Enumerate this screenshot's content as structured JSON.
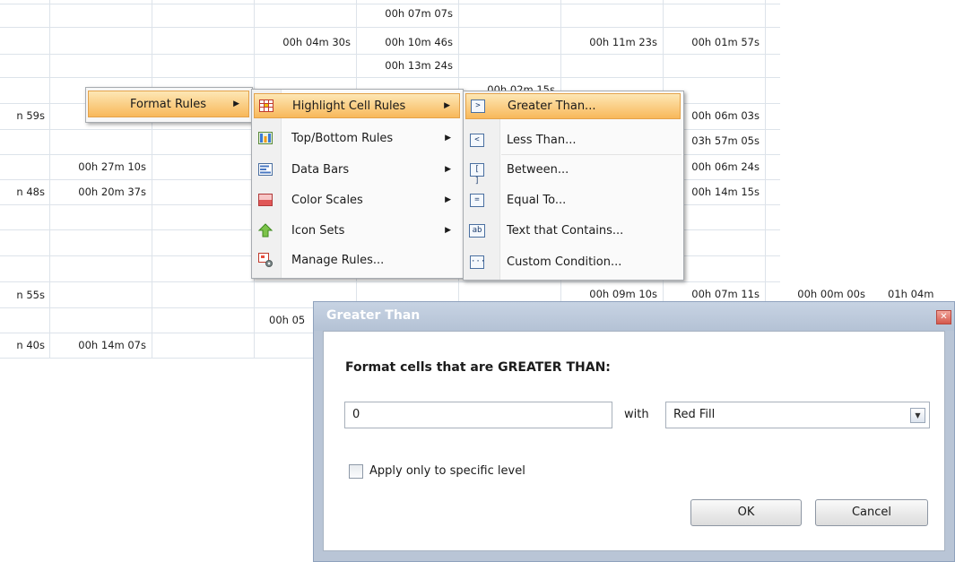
{
  "grid": {
    "cells": [
      {
        "id": "r0c4",
        "text": "00h 07m 07s"
      },
      {
        "id": "r1c3",
        "text": "00h 04m 30s"
      },
      {
        "id": "r1c4",
        "text": "00h 10m 46s"
      },
      {
        "id": "r1c6",
        "text": "00h 11m 23s"
      },
      {
        "id": "r1c7",
        "text": "00h 01m 57s"
      },
      {
        "id": "r2c4",
        "text": "00h 13m 24s"
      },
      {
        "id": "r3c5",
        "text": "00h 02m 15s"
      },
      {
        "id": "r4c0",
        "text": "n 59s"
      },
      {
        "id": "r4c7",
        "text": "00h 06m 03s"
      },
      {
        "id": "r5c7",
        "text": "03h 57m 05s"
      },
      {
        "id": "r6c1",
        "text": "00h 27m 10s"
      },
      {
        "id": "r6c7",
        "text": "00h 06m 24s"
      },
      {
        "id": "r7c0",
        "text": "n 48s"
      },
      {
        "id": "r7c1",
        "text": "00h 20m 37s"
      },
      {
        "id": "r7c7",
        "text": "00h 14m 15s"
      },
      {
        "id": "r10c0",
        "text": "n 55s"
      },
      {
        "id": "r10c6",
        "text": "00h 09m 10s"
      },
      {
        "id": "r10c7",
        "text": "00h 07m 11s"
      },
      {
        "id": "r10c8",
        "text": "00h 00m 00s"
      },
      {
        "id": "r10c9",
        "text": "01h 04m"
      },
      {
        "id": "r11c3",
        "text": "00h 05"
      },
      {
        "id": "r12c0",
        "text": "n 40s"
      },
      {
        "id": "r12c1",
        "text": "00h 14m 07s"
      }
    ]
  },
  "menus": {
    "root": {
      "label": "Format Rules",
      "arrow": "▶"
    },
    "format_rules": {
      "items": [
        {
          "label": "Highlight Cell Rules",
          "icon": "highlight-cell-rules-icon",
          "arrow": "▶"
        },
        {
          "label": "Top/Bottom Rules",
          "icon": "top-bottom-rules-icon",
          "arrow": "▶"
        },
        {
          "label": "Data Bars",
          "icon": "data-bars-icon",
          "arrow": "▶"
        },
        {
          "label": "Color Scales",
          "icon": "color-scales-icon",
          "arrow": "▶"
        },
        {
          "label": "Icon Sets",
          "icon": "icon-sets-icon",
          "arrow": "▶"
        },
        {
          "label": "Manage Rules...",
          "icon": "manage-rules-icon"
        }
      ]
    },
    "highlight_cell_rules": {
      "items": [
        {
          "label": "Greater Than...",
          "icon_text": ">"
        },
        {
          "label": "Less Than...",
          "icon_text": "<"
        },
        {
          "label": "Between...",
          "icon_text": "[ ]"
        },
        {
          "label": "Equal To...",
          "icon_text": "="
        },
        {
          "label": "Text that Contains...",
          "icon_text": "ab"
        },
        {
          "label": "Custom Condition...",
          "icon_text": "···"
        }
      ]
    }
  },
  "dialog": {
    "title": "Greater Than",
    "close_glyph": "✕",
    "heading": "Format cells that are GREATER THAN:",
    "value_input": "0",
    "with_label": "with",
    "format_select": "Red Fill",
    "dropdown_glyph": "▼",
    "checkbox_label": "Apply only to specific level",
    "checkbox_checked": false,
    "ok_label": "OK",
    "cancel_label": "Cancel"
  },
  "colors": {
    "menu_highlight": "#f8b85a",
    "dialog_frame": "#b9c5d6",
    "grid_line": "#dde3ea"
  }
}
